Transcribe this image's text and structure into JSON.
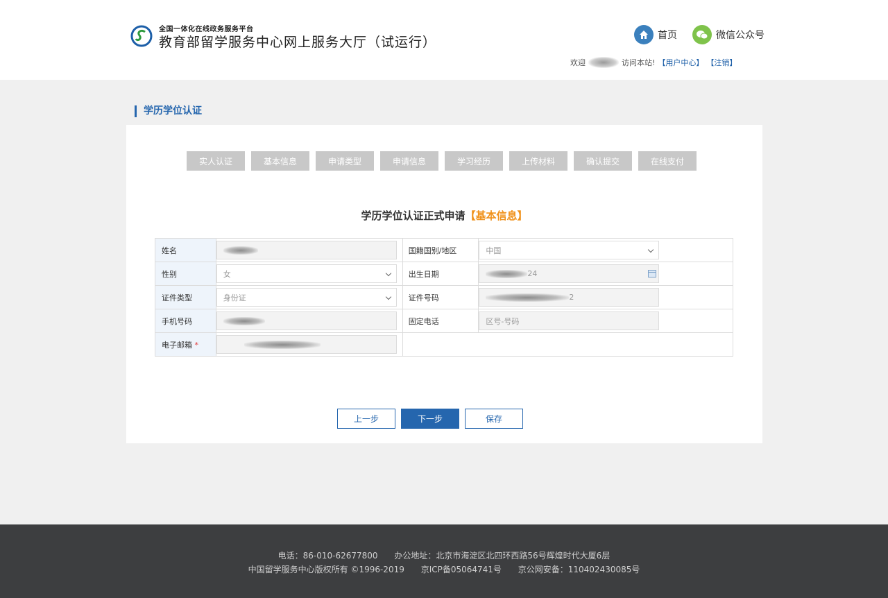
{
  "header": {
    "platform_small": "全国一体化在线政务服务平台",
    "platform_title": "教育部留学服务中心网上服务大厅（试运行）",
    "nav": {
      "home": "首页",
      "wechat": "微信公众号"
    },
    "welcome_prefix": "欢迎",
    "welcome_suffix": "访问本站!",
    "user_center": "【用户中心】",
    "logout": "【注销】"
  },
  "section_title": "学历学位认证",
  "steps": [
    "实人认证",
    "基本信息",
    "申请类型",
    "申请信息",
    "学习经历",
    "上传材料",
    "确认提交",
    "在线支付"
  ],
  "form": {
    "title": "学历学位认证正式申请",
    "title_highlight": "【基本信息】",
    "labels": {
      "name": "姓名",
      "nationality": "国籍国别/地区",
      "gender": "性别",
      "birth_date": "出生日期",
      "id_type": "证件类型",
      "id_number": "证件号码",
      "mobile": "手机号码",
      "landline": "固定电话",
      "email": "电子邮箱",
      "required_mark": "*"
    },
    "values": {
      "nationality": "中国",
      "gender": "女",
      "birth_date_tail": "24",
      "id_type": "身份证",
      "id_number_tail": "2",
      "landline_placeholder": "区号-号码"
    }
  },
  "buttons": {
    "prev": "上一步",
    "next": "下一步",
    "save": "保存"
  },
  "footer": {
    "phone": "电话：86-010-62677800",
    "address": "办公地址：北京市海淀区北四环西路56号辉煌时代大厦6层",
    "copyright": "中国留学服务中心版权所有 ©1996-2019",
    "icp": "京ICP备05064741号",
    "police": "京公网安备：110402430085号"
  },
  "colors": {
    "primary": "#2566ae",
    "highlight": "#f0921c",
    "step_bg": "#c8c8c8",
    "footer_bg": "#3d3e40"
  }
}
